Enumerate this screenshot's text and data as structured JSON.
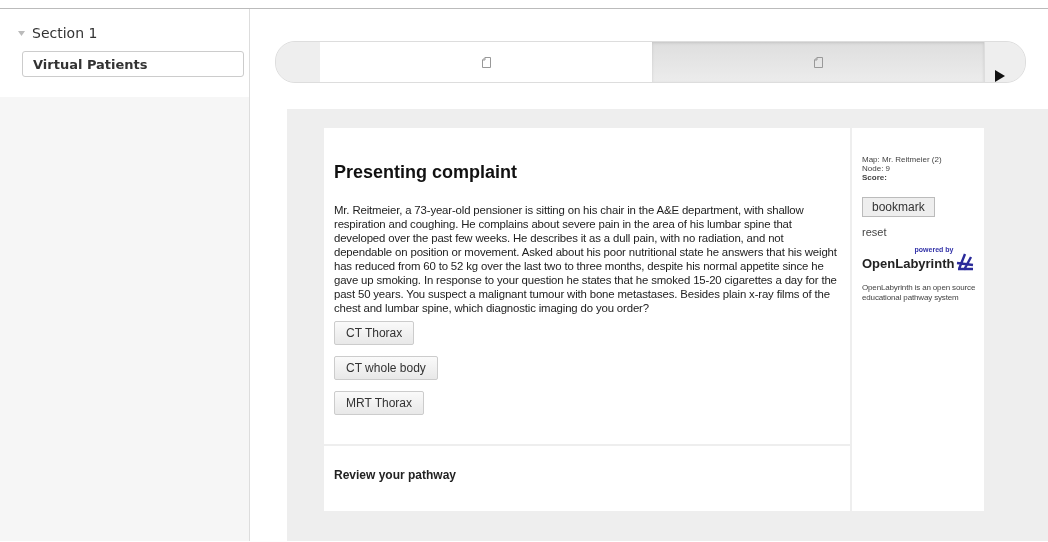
{
  "sidebar": {
    "section": {
      "title": "Section 1",
      "expanded": true
    },
    "items": [
      {
        "label": "Virtual Patients"
      }
    ]
  },
  "carousel": {
    "slides": [
      {
        "selected": false
      },
      {
        "selected": true
      }
    ]
  },
  "node": {
    "title": "Presenting complaint",
    "text": "Mr. Reitmeier, a 73-year-old pensioner is sitting on his chair in the A&E department, with shallow respiration and coughing. He complains about severe pain in the area of his lumbar spine that developed over the past few weeks. He describes it as a dull pain, with no radiation, and not dependable on position or movement. Asked about his poor nutritional state he answers that his weight has reduced from 60 to 52 kg over the last two to three months, despite his normal appetite since he gave up smoking. In response to your question he states that he smoked 15-20 cigarettes a day for the past 50 years. You suspect a malignant tumour with bone metastases. Besides plain x-ray films of the chest and lumbar spine, which diagnostic imaging do you order?",
    "options": [
      "CT Thorax",
      "CT whole body",
      "MRT Thorax"
    ],
    "review": "Review your pathway"
  },
  "info": {
    "map": "Map: Mr. Reitmeier (2)",
    "node": "Node: 9",
    "score": "Score:",
    "bookmark": "bookmark",
    "reset": "reset",
    "powered_by": "powered by",
    "brand": "OpenLabyrinth",
    "description": "OpenLabyrinth is an open source educational pathway system"
  }
}
